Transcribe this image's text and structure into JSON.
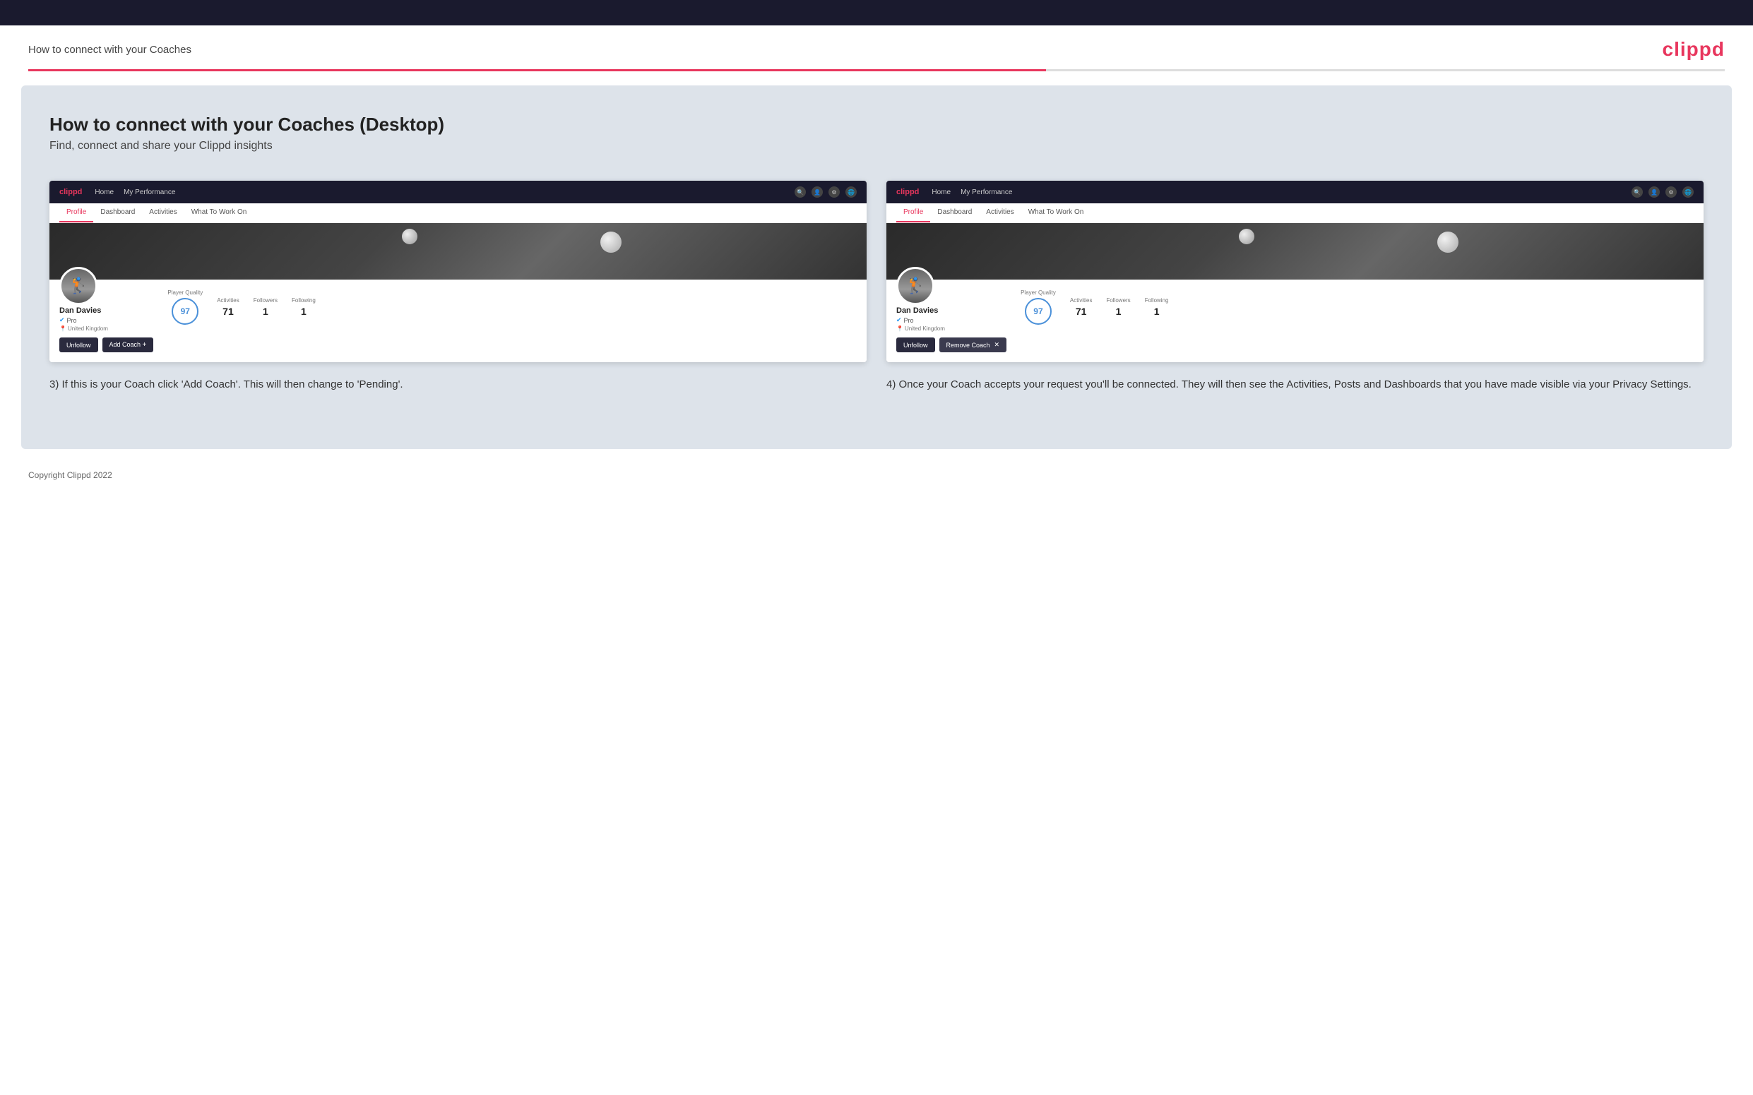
{
  "top_bar": {},
  "header": {
    "title": "How to connect with your Coaches",
    "logo": "clippd"
  },
  "main": {
    "heading": "How to connect with your Coaches (Desktop)",
    "subheading": "Find, connect and share your Clippd insights",
    "screenshot_left": {
      "nav": {
        "logo": "clippd",
        "items": [
          "Home",
          "My Performance"
        ],
        "icons": [
          "search",
          "profile",
          "settings",
          "globe"
        ]
      },
      "tabs": [
        "Profile",
        "Dashboard",
        "Activities",
        "What To Work On"
      ],
      "active_tab": "Profile",
      "profile": {
        "name": "Dan Davies",
        "tag": "Pro",
        "location": "United Kingdom",
        "player_quality_label": "Player Quality",
        "player_quality_value": "97",
        "activities_label": "Activities",
        "activities_value": "71",
        "followers_label": "Followers",
        "followers_value": "1",
        "following_label": "Following",
        "following_value": "1"
      },
      "buttons": {
        "unfollow": "Unfollow",
        "add_coach": "Add Coach"
      }
    },
    "screenshot_right": {
      "nav": {
        "logo": "clippd",
        "items": [
          "Home",
          "My Performance"
        ],
        "icons": [
          "search",
          "profile",
          "settings",
          "globe"
        ]
      },
      "tabs": [
        "Profile",
        "Dashboard",
        "Activities",
        "What To Work On"
      ],
      "active_tab": "Profile",
      "profile": {
        "name": "Dan Davies",
        "tag": "Pro",
        "location": "United Kingdom",
        "player_quality_label": "Player Quality",
        "player_quality_value": "97",
        "activities_label": "Activities",
        "activities_value": "71",
        "followers_label": "Followers",
        "followers_value": "1",
        "following_label": "Following",
        "following_value": "1"
      },
      "buttons": {
        "unfollow": "Unfollow",
        "remove_coach": "Remove Coach"
      }
    },
    "caption_left": "3) If this is your Coach click 'Add Coach'. This will then change to 'Pending'.",
    "caption_right": "4) Once your Coach accepts your request you'll be connected. They will then see the Activities, Posts and Dashboards that you have made visible via your Privacy Settings."
  },
  "footer": {
    "copyright": "Copyright Clippd 2022"
  }
}
